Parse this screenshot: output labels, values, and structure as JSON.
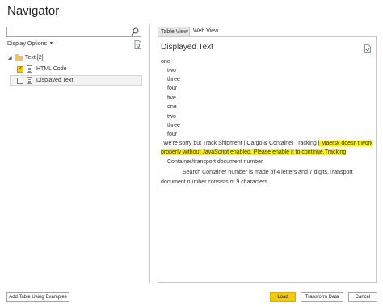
{
  "window": {
    "title": "Navigator"
  },
  "left_pane": {
    "search": {
      "value": ""
    },
    "display_options_label": "Display Options",
    "tree": {
      "root_label": "Text [2]",
      "items": [
        {
          "label": "HTML Code",
          "checked": true
        },
        {
          "label": "Displayed Text",
          "checked": false,
          "selected": true
        }
      ]
    }
  },
  "right_pane": {
    "tabs": [
      {
        "label": "Table View",
        "active": true
      },
      {
        "label": "Web View",
        "active": false
      }
    ],
    "title": "Displayed Text",
    "lines": [
      "one",
      "two",
      "three",
      "four",
      "five",
      "one",
      "two",
      "three",
      "four"
    ],
    "para1_normal": "We're sorry but Track Shipment | Cargo & Container Tracking",
    "para1_highlight_a": "| Maersk doesn't work",
    "para1_highlight_b": "properly without JavaScript enabled. Please enable it to continue.Tracking",
    "container_label": "Container/transport document number",
    "search_line": "Search  Container number is made of 4 letters and 7 digits.Transport",
    "search_line_2": "document number consists of 9 characters.",
    "highlight_color": "#fff200"
  },
  "footer": {
    "add_table_label": "Add Table Using Examples",
    "load_label": "Load",
    "transform_label": "Transform Data",
    "cancel_label": "Cancel"
  },
  "icons": {
    "search": "search-icon",
    "refresh": "refresh-icon",
    "export": "export-icon"
  }
}
